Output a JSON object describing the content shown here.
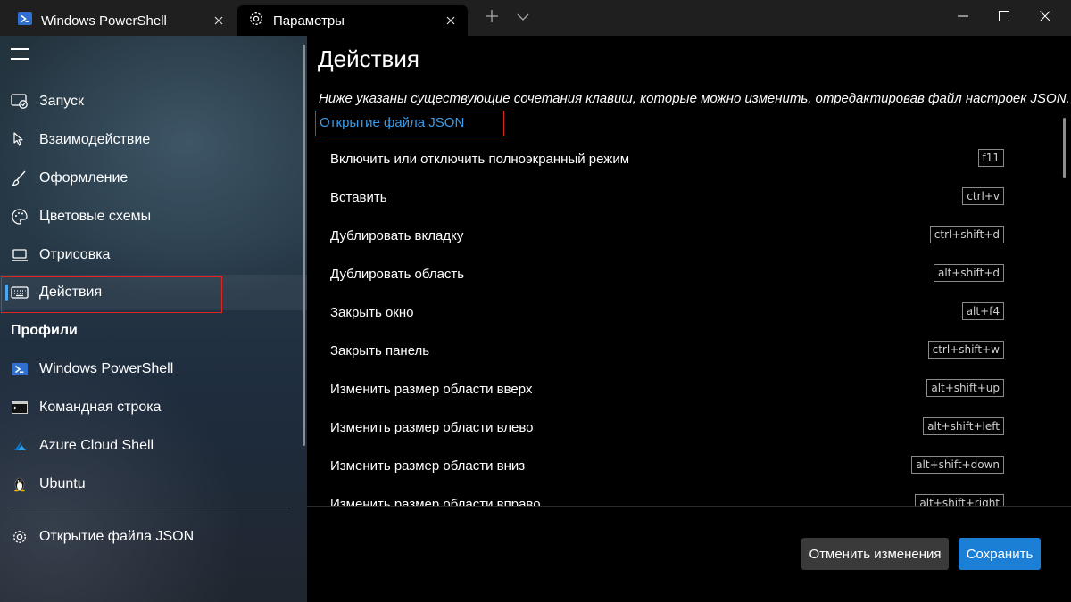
{
  "tabs": [
    {
      "label": "Windows PowerShell",
      "icon": "powershell-icon"
    },
    {
      "label": "Параметры",
      "icon": "gear-icon"
    }
  ],
  "sidebar": {
    "items": [
      {
        "label": "Запуск",
        "icon": "startup-icon"
      },
      {
        "label": "Взаимодействие",
        "icon": "interaction-icon"
      },
      {
        "label": "Оформление",
        "icon": "brush-icon"
      },
      {
        "label": "Цветовые схемы",
        "icon": "palette-icon"
      },
      {
        "label": "Отрисовка",
        "icon": "laptop-icon"
      },
      {
        "label": "Действия",
        "icon": "keyboard-icon",
        "selected": true
      }
    ],
    "profiles_header": "Профили",
    "profiles": [
      {
        "label": "Windows PowerShell",
        "icon": "powershell-icon"
      },
      {
        "label": "Командная строка",
        "icon": "cmd-icon"
      },
      {
        "label": "Azure Cloud Shell",
        "icon": "azure-icon"
      },
      {
        "label": "Ubuntu",
        "icon": "linux-icon"
      }
    ],
    "open_json": {
      "label": "Открытие файла JSON",
      "icon": "gear-icon"
    }
  },
  "main": {
    "title": "Действия",
    "description": "Ниже указаны существующие сочетания клавиш, которые можно изменить, отредактировав файл настроек JSON.",
    "json_link": "Открытие файла JSON",
    "actions": [
      {
        "name": "Включить или отключить полноэкранный режим",
        "keys": "f11"
      },
      {
        "name": "Вставить",
        "keys": "ctrl+v"
      },
      {
        "name": "Дублировать вкладку",
        "keys": "ctrl+shift+d"
      },
      {
        "name": "Дублировать область",
        "keys": "alt+shift+d"
      },
      {
        "name": "Закрыть окно",
        "keys": "alt+f4"
      },
      {
        "name": "Закрыть панель",
        "keys": "ctrl+shift+w"
      },
      {
        "name": "Изменить размер области вверх",
        "keys": "alt+shift+up"
      },
      {
        "name": "Изменить размер области влево",
        "keys": "alt+shift+left"
      },
      {
        "name": "Изменить размер области вниз",
        "keys": "alt+shift+down"
      },
      {
        "name": "Изменить размер области вправо",
        "keys": "alt+shift+right"
      }
    ]
  },
  "buttons": {
    "discard": "Отменить изменения",
    "save": "Сохранить"
  },
  "colors": {
    "accent": "#1c7fd6",
    "link": "#3b9ce8",
    "highlight": "#e02424"
  }
}
